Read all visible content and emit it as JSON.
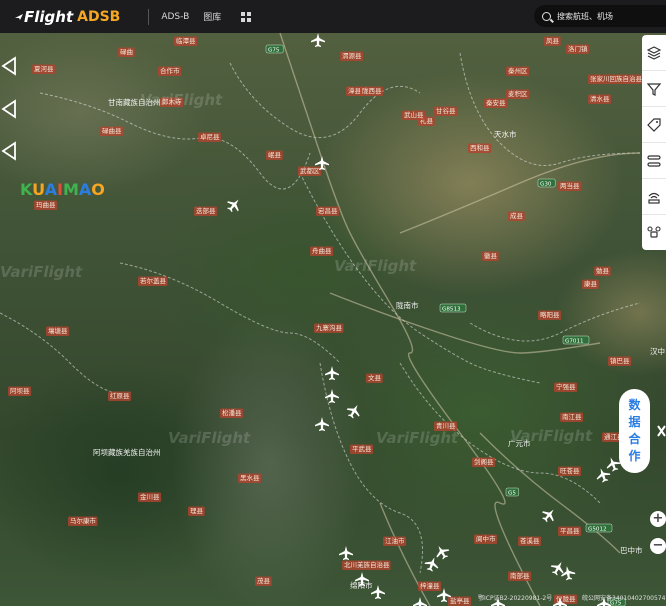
{
  "header": {
    "logo_main": "Flight",
    "logo_sub": "ADSB",
    "nav": [
      "ADS-B",
      "图库"
    ],
    "search_placeholder": "搜索航班、机场"
  },
  "map": {
    "watermarks": [
      "VariFlight",
      "VariFlight",
      "VariFlight",
      "VariFlight",
      "VariFlight",
      "VariFlight"
    ],
    "brand_watermark": "KUAIMAO",
    "places": [
      {
        "name": "甘南藏族自治州",
        "kind": "text"
      },
      {
        "name": "天水市",
        "kind": "text"
      },
      {
        "name": "陇南市",
        "kind": "text"
      },
      {
        "name": "广元市",
        "kind": "text"
      },
      {
        "name": "绵阳市",
        "kind": "text"
      },
      {
        "name": "阿坝藏族羌族自治州",
        "kind": "text"
      },
      {
        "name": "巴中市",
        "kind": "text"
      },
      {
        "name": "汉中",
        "kind": "text"
      },
      {
        "name": "合作市",
        "kind": "county"
      },
      {
        "name": "碌曲县",
        "kind": "county"
      },
      {
        "name": "迭部县",
        "kind": "county"
      },
      {
        "name": "舟曲县",
        "kind": "county"
      },
      {
        "name": "岷县",
        "kind": "county"
      },
      {
        "name": "宕昌县",
        "kind": "county"
      },
      {
        "name": "文县",
        "kind": "county"
      },
      {
        "name": "武都区",
        "kind": "county"
      },
      {
        "name": "礼县",
        "kind": "county"
      },
      {
        "name": "西和县",
        "kind": "county"
      },
      {
        "name": "成县",
        "kind": "county"
      },
      {
        "name": "徽县",
        "kind": "county"
      },
      {
        "name": "若尔盖县",
        "kind": "county"
      },
      {
        "name": "九寨沟县",
        "kind": "county"
      },
      {
        "name": "平武县",
        "kind": "county"
      },
      {
        "name": "青川县",
        "kind": "county"
      },
      {
        "name": "松潘县",
        "kind": "county"
      },
      {
        "name": "北川羌族自治县",
        "kind": "county"
      },
      {
        "name": "剑阁县",
        "kind": "county"
      },
      {
        "name": "旺苍县",
        "kind": "county"
      },
      {
        "name": "苍溪县",
        "kind": "county"
      },
      {
        "name": "江油市",
        "kind": "county"
      },
      {
        "name": "梓潼县",
        "kind": "county"
      },
      {
        "name": "茂县",
        "kind": "county"
      },
      {
        "name": "黑水县",
        "kind": "county"
      },
      {
        "name": "马尔康市",
        "kind": "county"
      },
      {
        "name": "红原县",
        "kind": "county"
      },
      {
        "name": "阿坝县",
        "kind": "county"
      },
      {
        "name": "玛曲县",
        "kind": "county"
      },
      {
        "name": "夏河县",
        "kind": "county"
      },
      {
        "name": "临潭县",
        "kind": "county"
      },
      {
        "name": "卓尼县",
        "kind": "county"
      },
      {
        "name": "渭源县",
        "kind": "county"
      },
      {
        "name": "漳县",
        "kind": "county"
      },
      {
        "name": "武山县",
        "kind": "county"
      },
      {
        "name": "甘谷县",
        "kind": "county"
      },
      {
        "name": "秦安县",
        "kind": "county"
      },
      {
        "name": "两当县",
        "kind": "county"
      },
      {
        "name": "略阳县",
        "kind": "county"
      },
      {
        "name": "宁强县",
        "kind": "county"
      },
      {
        "name": "勉县",
        "kind": "county"
      },
      {
        "name": "南江县",
        "kind": "county"
      },
      {
        "name": "凤县",
        "kind": "county"
      },
      {
        "name": "清水县",
        "kind": "county"
      },
      {
        "name": "张家川回族自治县",
        "kind": "county"
      },
      {
        "name": "通江县",
        "kind": "county"
      },
      {
        "name": "康县",
        "kind": "county"
      },
      {
        "name": "陇西县",
        "kind": "county"
      },
      {
        "name": "壤塘县",
        "kind": "county"
      },
      {
        "name": "金川县",
        "kind": "county"
      },
      {
        "name": "理县",
        "kind": "county"
      },
      {
        "name": "安州区",
        "kind": "county"
      },
      {
        "name": "盐亭县",
        "kind": "county"
      },
      {
        "name": "南部县",
        "kind": "county"
      },
      {
        "name": "阆中市",
        "kind": "county"
      },
      {
        "name": "仪陇县",
        "kind": "county"
      },
      {
        "name": "平昌县",
        "kind": "county"
      },
      {
        "name": "镇巴县",
        "kind": "county"
      },
      {
        "name": "碌曲",
        "kind": "county"
      },
      {
        "name": "郎木寺",
        "kind": "county"
      },
      {
        "name": "洛门镇",
        "kind": "county"
      },
      {
        "name": "麦积区",
        "kind": "county"
      },
      {
        "name": "秦州区",
        "kind": "county"
      }
    ],
    "roads": [
      "G75",
      "G30",
      "G8513",
      "G7011",
      "G5",
      "G5012",
      "G75"
    ],
    "aircraft_count": 22
  },
  "toolbar": {
    "icons": [
      "layers-icon",
      "filter-icon",
      "tag-icon",
      "route-icon",
      "radar-icon",
      "drone-icon"
    ]
  },
  "cooperate": {
    "chars": [
      "数",
      "据",
      "合",
      "作"
    ]
  },
  "zoom": {
    "in": "+",
    "out": "−"
  },
  "footer": {
    "icp": "鄂ICP证B2-20220981-2号",
    "police": "皖公网安备34010402700574"
  },
  "colors": {
    "topbar": "#1c1c1e",
    "accent": "#f5a623",
    "link": "#2a7de1",
    "label_bg": "#b5432e"
  }
}
